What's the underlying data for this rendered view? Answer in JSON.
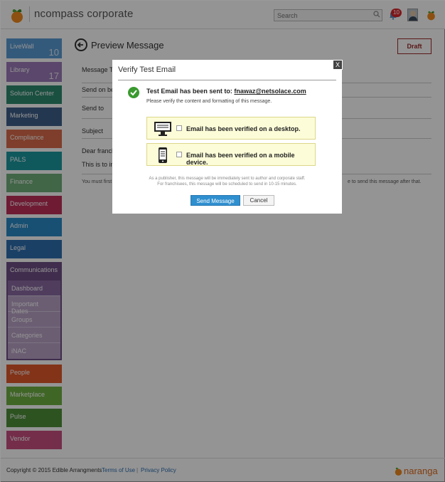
{
  "header": {
    "app_title": "ncompass corporate",
    "search_placeholder": "Search",
    "notification_count": "10"
  },
  "sidebar": {
    "items": [
      {
        "label": "LiveWall",
        "count": "10",
        "color": "#5b9bd5"
      },
      {
        "label": "Library",
        "count": "17",
        "color": "#9b7bb8"
      },
      {
        "label": "Solution Center",
        "count": "",
        "color": "#2e8b6e"
      },
      {
        "label": "Marketing",
        "count": "",
        "color": "#3f5f8a"
      },
      {
        "label": "Compliance",
        "count": "",
        "color": "#d96c4a"
      },
      {
        "label": "PALS",
        "count": "",
        "color": "#1a9aa0"
      },
      {
        "label": "Finance",
        "count": "",
        "color": "#6fae7b"
      },
      {
        "label": "Development",
        "count": "",
        "color": "#c0305a"
      },
      {
        "label": "Admin",
        "count": "",
        "color": "#2a8bc7"
      },
      {
        "label": "Legal",
        "count": "",
        "color": "#2e6fb0"
      }
    ],
    "active": {
      "label": "Communications",
      "color": "#6e4f86"
    },
    "sub_items": [
      "Dashboard",
      "Important Dates",
      "Groups",
      "Categories",
      "iNAC"
    ],
    "items_after": [
      {
        "label": "People",
        "color": "#e0582a"
      },
      {
        "label": "Marketplace",
        "color": "#6fb043"
      },
      {
        "label": "Pulse",
        "color": "#4f8f3a"
      },
      {
        "label": "Vendor",
        "color": "#c9507f"
      }
    ]
  },
  "main": {
    "page_title": "Preview Message",
    "draft_label": "Draft",
    "rows": [
      "Message Ty",
      "Send on be",
      "Send to",
      "Subject"
    ],
    "body_lines": [
      "Dear franch",
      "This is to in"
    ],
    "hint_left": "You must first",
    "hint_right": "e to send this message after that."
  },
  "modal": {
    "title": "Verify Test Email",
    "close_label": "X",
    "sent_prefix": "Test Email has been sent to:",
    "sent_email": "fnawaz@netsolace.com",
    "verify_instructions": "Please verify the content and formatting of this message.",
    "desktop_label": "Email has been verified on a desktop.",
    "mobile_label": "Email has been verified on a mobile device.",
    "publisher_note_1": "As a publisher, this message will be immediately sent to author and corporate staff.",
    "publisher_note_2": "For franchisees, this message will be scheduled to send in 10-15 minutes.",
    "send_label": "Send Message",
    "cancel_label": "Cancel"
  },
  "footer": {
    "copyright": "Copyright © 2015 Edible Arrangments",
    "terms": "Terms of Use",
    "separator": "|",
    "privacy": "Privacy Policy",
    "brand": "naranga"
  }
}
